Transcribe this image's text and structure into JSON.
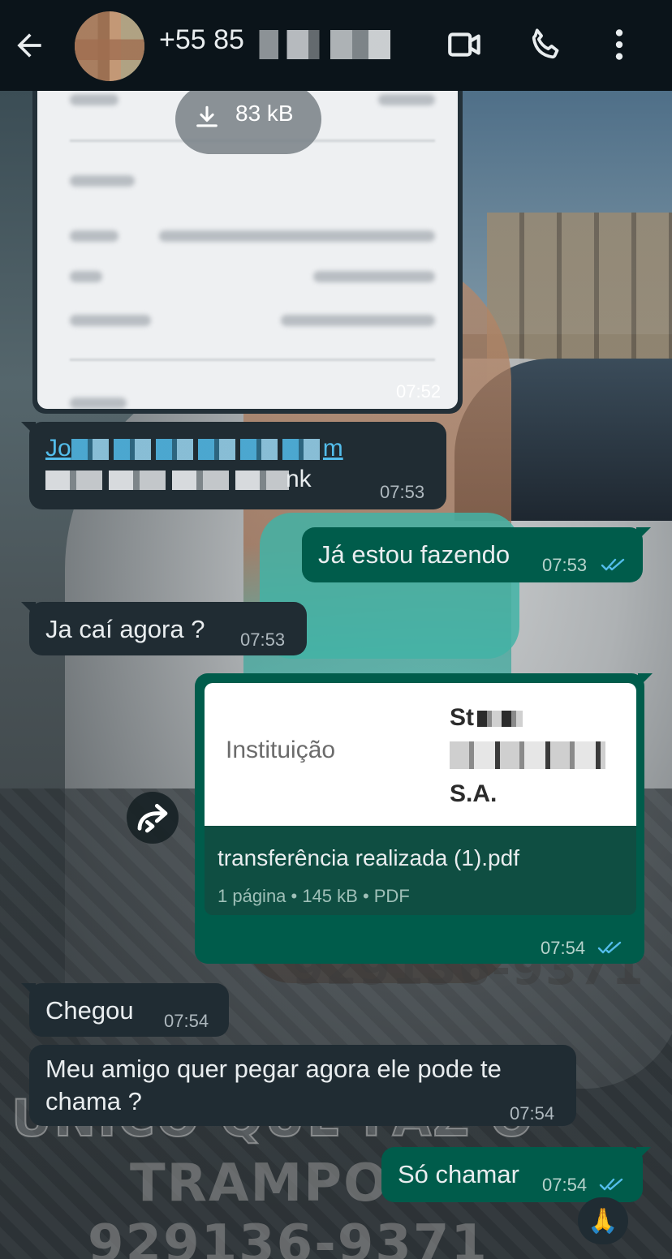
{
  "header": {
    "back_icon": "arrow-left-icon",
    "contact_name": "+55 85",
    "video_icon": "video-camera-icon",
    "call_icon": "phone-icon",
    "menu_icon": "more-vertical-icon"
  },
  "messages": {
    "image": {
      "download_size": "83 kB",
      "time": "07:52"
    },
    "email": {
      "partial_link": "Jo",
      "link_end": "m",
      "trailing": "nk",
      "time": "07:53"
    },
    "m1": {
      "text": "Já estou fazendo",
      "time": "07:53",
      "status": "read"
    },
    "m2": {
      "text": "Ja caí agora ?",
      "time": "07:53"
    },
    "pdf": {
      "preview_label": "Instituição",
      "preview_value_top": "St",
      "preview_value_bottom": "S.A.",
      "filename": "transferência realizada  (1).pdf",
      "meta": "1 página • 145 kB • PDF",
      "time": "07:54",
      "status": "read"
    },
    "m3": {
      "text": "Chegou",
      "time": "07:54"
    },
    "m4": {
      "line1": "Meu amigo quer pegar agora ele pode te",
      "line2": "chama ?",
      "time": "07:54"
    },
    "m5": {
      "text": "Só chamar",
      "time": "07:54",
      "status": "read",
      "reaction": "🙏"
    }
  },
  "wallpaper_text": {
    "line1": "UNICO QUE FAZ O",
    "line2": "TRAMPO",
    "line3": "929136-9371",
    "car_plate": "929136-9371"
  },
  "colors": {
    "header_bg": "#0b141a",
    "incoming_bubble": "#202c33",
    "outgoing_bubble": "#005c4b",
    "read_ticks": "#53bdeb"
  }
}
